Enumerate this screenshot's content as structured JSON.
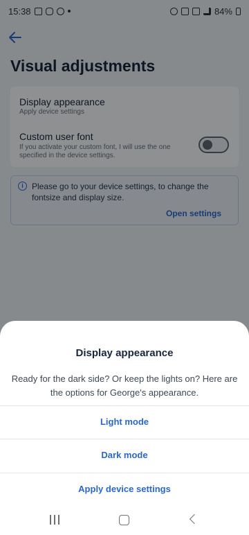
{
  "status_bar": {
    "time": "15:38",
    "battery": "84%"
  },
  "screen": {
    "title": "Visual adjustments",
    "display_appearance": {
      "title": "Display appearance",
      "subtitle": "Apply device settings"
    },
    "custom_font": {
      "title": "Custom user font",
      "subtitle": "If you activate your custom font, I will use the one specified in the device settings.",
      "enabled": false
    },
    "info": {
      "text": "Please go to your device settings, to change the fontsize and display size.",
      "link": "Open settings"
    }
  },
  "sheet": {
    "title": "Display appearance",
    "description": "Ready for the dark side? Or keep the lights on? Here are the options for George's appearance.",
    "options": [
      "Light mode",
      "Dark mode",
      "Apply device settings"
    ]
  },
  "colors": {
    "accent": "#2b67c8",
    "title_text": "#19273c"
  },
  "icons": {
    "back": "arrow-left-icon",
    "info": "info-icon",
    "nav_recents": "recents-icon",
    "nav_home": "home-icon",
    "nav_back": "nav-back-icon"
  }
}
